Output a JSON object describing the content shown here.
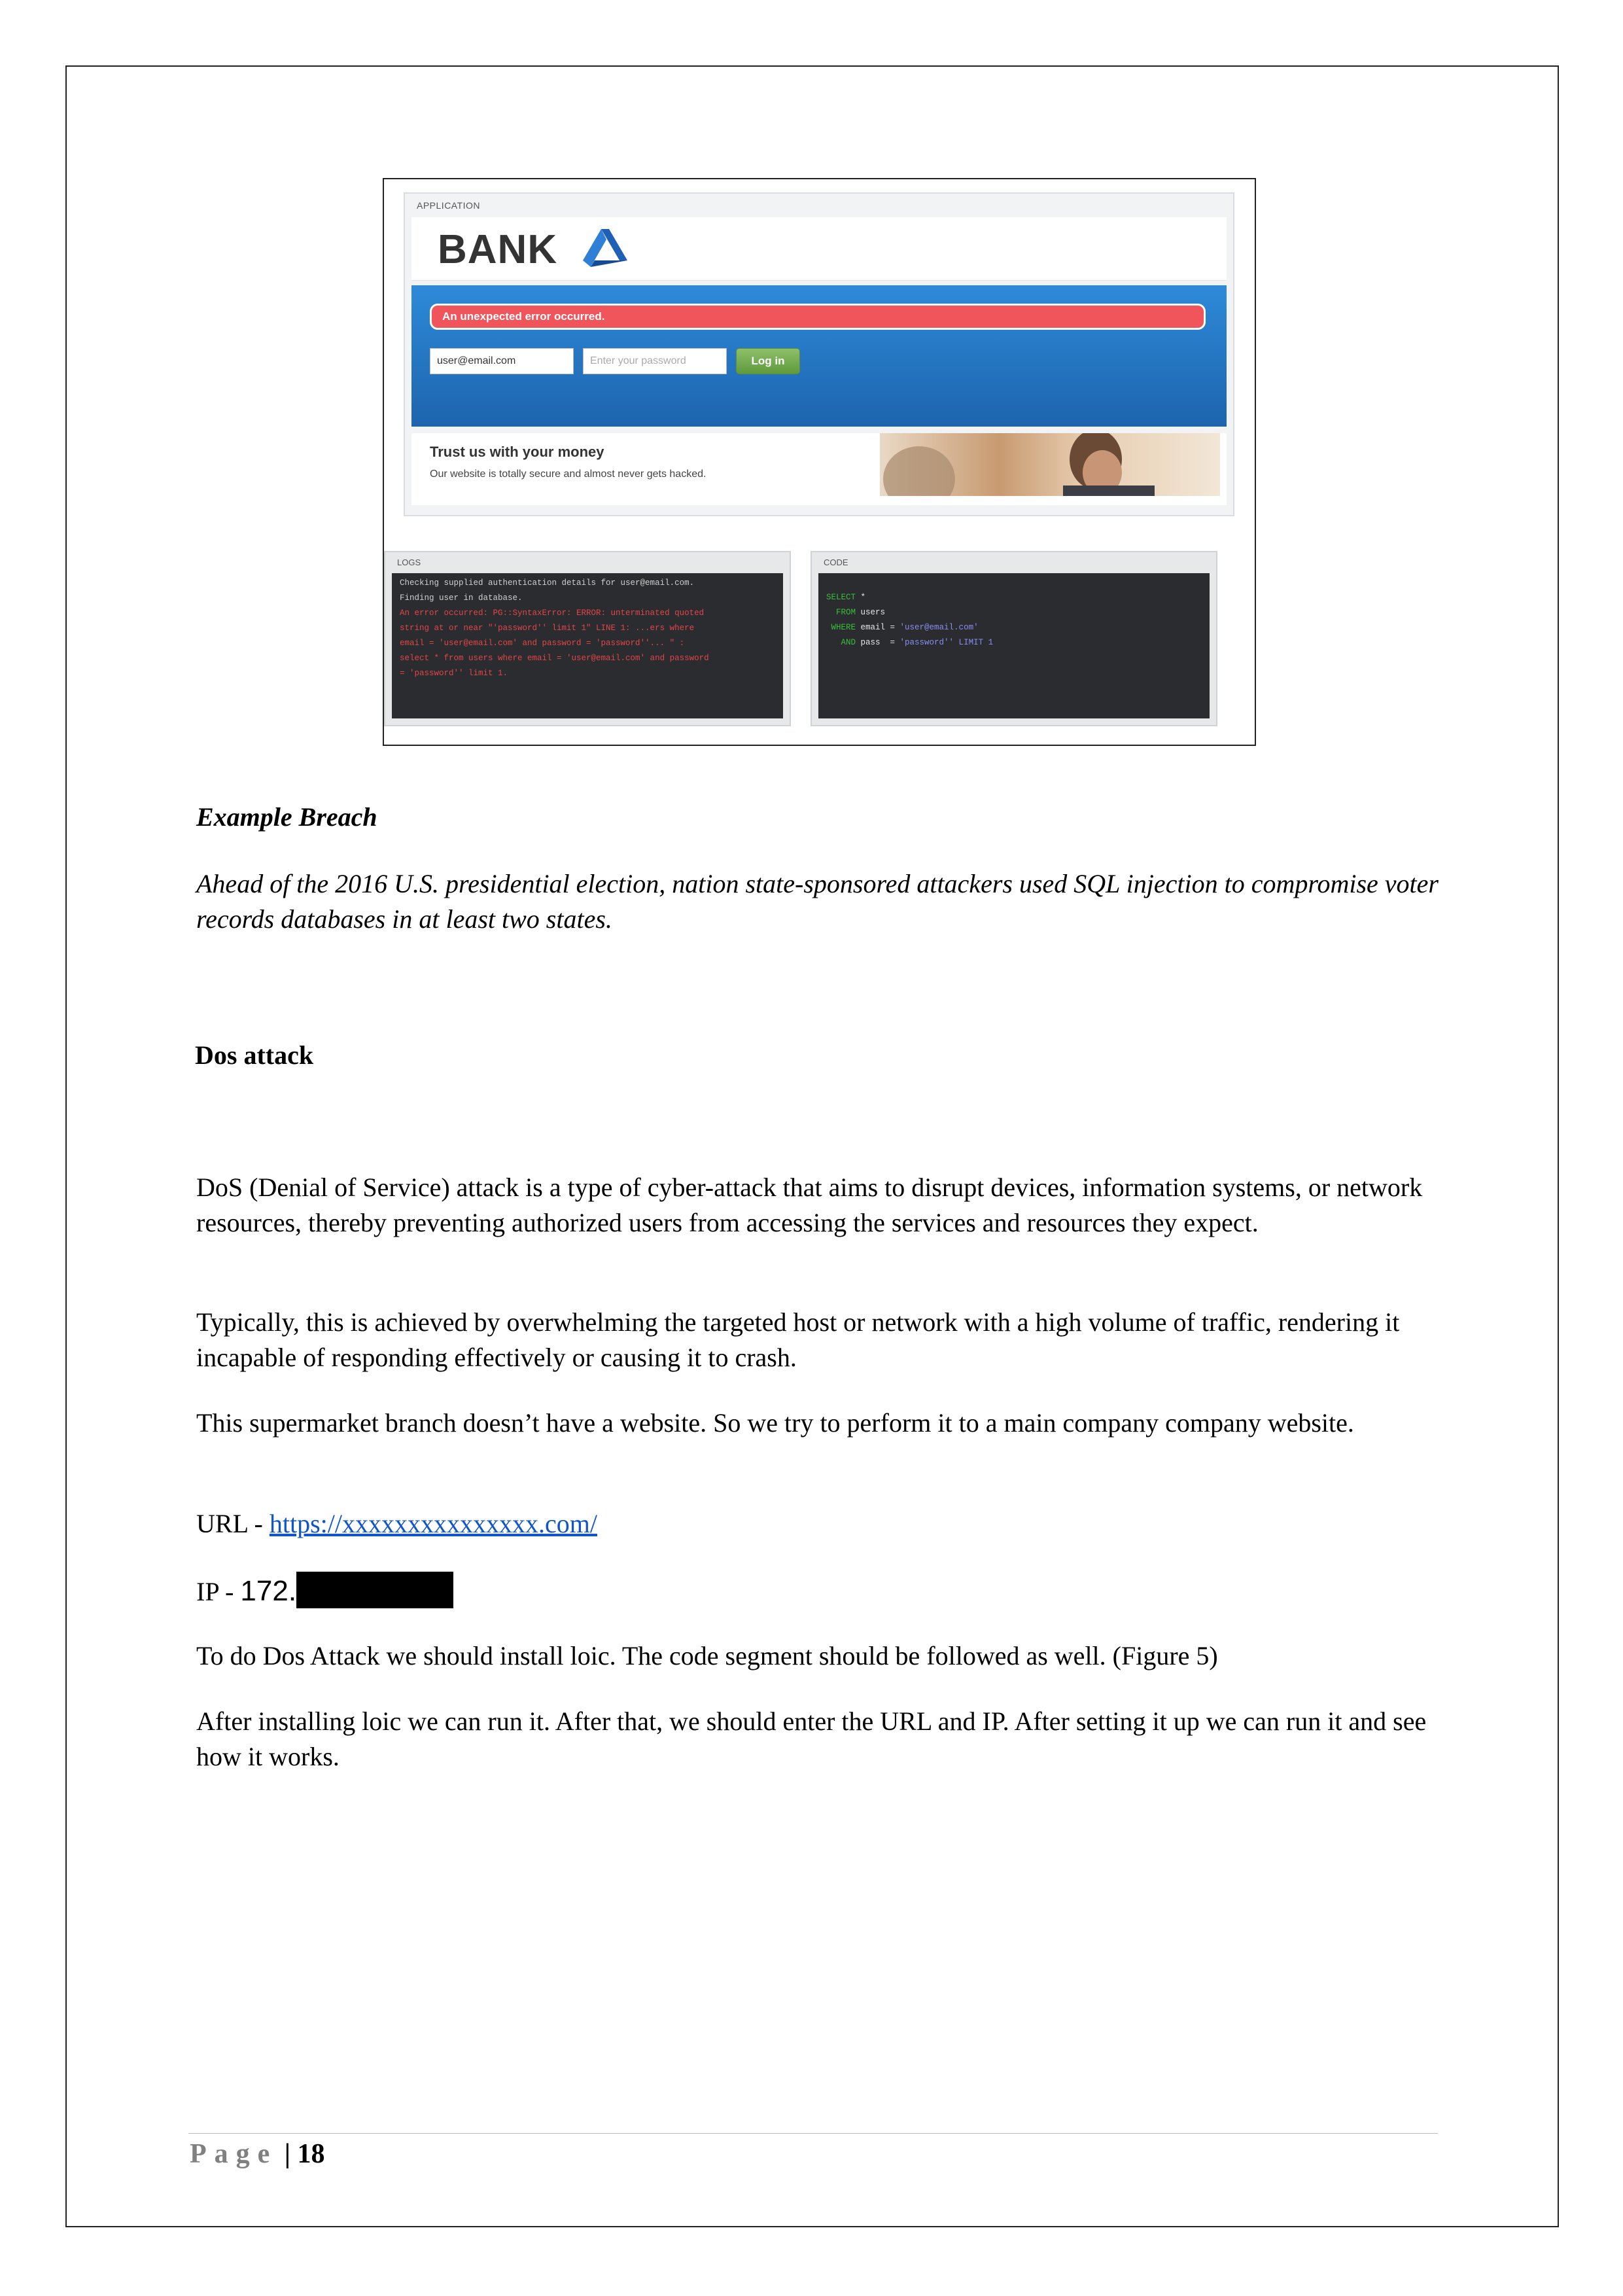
{
  "screenshot": {
    "app_label": "APPLICATION",
    "brand": "BANK",
    "error": "An unexpected error occurred.",
    "email_value": "user@email.com",
    "password_placeholder": "Enter your password",
    "login_label": "Log in",
    "promo_title": "Trust us with your money",
    "promo_sub": "Our website is totally secure and almost never gets hacked.",
    "logs_label": "LOGS",
    "code_label": "CODE",
    "logs": [
      {
        "text": "Checking supplied authentication details for user@email.com.",
        "error": false
      },
      {
        "text": "Finding user in database.",
        "error": false
      },
      {
        "text": "An error occurred: PG::SyntaxError: ERROR: unterminated quoted",
        "error": true
      },
      {
        "text": "string at or near \"'password'' limit 1\" LINE 1: ...ers where",
        "error": true
      },
      {
        "text": "email = 'user@email.com' and password = 'password''... \" :",
        "error": true
      },
      {
        "text": "select * from users where email = 'user@email.com' and password",
        "error": true
      },
      {
        "text": "= 'password'' limit 1.",
        "error": true
      }
    ],
    "code": {
      "line1_kw": "SELECT",
      "line1_rest": " *",
      "line2_kw": "FROM",
      "line2_rest": " users",
      "line3_kw": "WHERE",
      "line3_col": " email = ",
      "line3_val": "'user@email.com'",
      "line4_kw": "AND",
      "line4_col": " pass  = ",
      "line4_val": "'password'' LIMIT 1"
    }
  },
  "example_heading": "Example Breach",
  "example_text": "Ahead of the 2016 U.S. presidential election, nation state-sponsored attackers used SQL injection to compromise voter records databases in at least two states.",
  "dos_heading": "Dos attack",
  "para1": "DoS (Denial of Service) attack is a type of cyber-attack that aims to disrupt devices, information systems, or network resources, thereby preventing authorized users from accessing the services and resources they expect.",
  "para2": "Typically, this is achieved by overwhelming the targeted host or network with a high volume of traffic, rendering it incapable of responding effectively or causing it to crash.",
  "para3": "This supermarket branch doesn’t have a website. So we try to perform it to a main company company website.",
  "url_label": "URL - ",
  "url_value": "https://xxxxxxxxxxxxxxx.com/",
  "ip_label": "IP - ",
  "ip_prefix": "172.",
  "para4": "To do Dos Attack we should install loic. The code segment should be followed as well. (Figure 5)",
  "para5": "After installing loic we can run it. After that, we should enter the URL and IP. After setting it up we can run it and see how it works.",
  "footer_page": "Page",
  "footer_sep": " | ",
  "footer_num": "18"
}
